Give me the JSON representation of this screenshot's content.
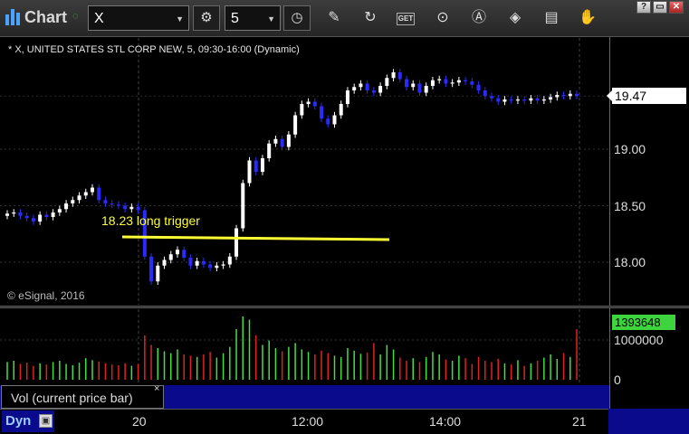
{
  "toolbar": {
    "title": "Chart",
    "symbol": "X",
    "interval": "5",
    "icons": [
      "gear-icon",
      "clock-icon",
      "pencil-icon",
      "refresh-icon",
      "get-icon",
      "play-icon",
      "alert-icon",
      "tag-icon",
      "message-icon",
      "thumb-icon"
    ],
    "get_label": "GET",
    "window_buttons": [
      "?",
      "▭",
      "✕"
    ]
  },
  "chart": {
    "symbol_line": "* X, UNITED STATES STL CORP NEW, 5, 09:30-16:00 (Dynamic)",
    "copyright": "© eSignal, 2016",
    "annotation": "18.23 long trigger",
    "last_price": "19.47",
    "y_ticks": [
      "19.00",
      "18.50",
      "18.00"
    ],
    "vol_last": "1393648",
    "vol_ticks": [
      "1000000",
      "0"
    ],
    "vol_label": "Vol (current price bar)",
    "vol_close": "×",
    "dyn": "Dyn",
    "x_ticks": [
      "20",
      "12:00",
      "14:00",
      "21"
    ],
    "colors": {
      "up": "#ffffff",
      "down": "#2a2aff",
      "vol_up": "#44dd44",
      "vol_down": "#dd2222",
      "trigger": "#ffff33"
    }
  },
  "chart_data": {
    "type": "line",
    "y_range": [
      17.7,
      19.8
    ],
    "trigger_price": 18.23,
    "closes": [
      18.43,
      18.44,
      18.41,
      18.39,
      18.36,
      18.42,
      18.4,
      18.44,
      18.47,
      18.52,
      18.55,
      18.59,
      18.62,
      18.66,
      18.55,
      18.52,
      18.51,
      18.5,
      18.47,
      18.49,
      18.46,
      18.05,
      17.83,
      17.97,
      18.02,
      18.07,
      18.11,
      18.04,
      17.97,
      18.01,
      17.98,
      17.95,
      17.97,
      17.98,
      18.05,
      18.3,
      18.7,
      18.9,
      18.8,
      18.92,
      19.05,
      19.09,
      19.02,
      19.13,
      19.3,
      19.4,
      19.42,
      19.38,
      19.27,
      19.22,
      19.3,
      19.4,
      19.52,
      19.55,
      19.58,
      19.52,
      19.5,
      19.56,
      19.63,
      19.68,
      19.62,
      19.55,
      19.58,
      19.5,
      19.56,
      19.61,
      19.62,
      19.58,
      19.59,
      19.61,
      19.6,
      19.57,
      19.52,
      19.47,
      19.45,
      19.42,
      19.44,
      19.43,
      19.44,
      19.43,
      19.45,
      19.43,
      19.44,
      19.46,
      19.48,
      19.47,
      19.49,
      19.47
    ],
    "volumes_rel": [
      0.28,
      0.3,
      0.25,
      0.27,
      0.22,
      0.26,
      0.24,
      0.28,
      0.3,
      0.25,
      0.23,
      0.27,
      0.34,
      0.31,
      0.29,
      0.26,
      0.24,
      0.23,
      0.26,
      0.22,
      0.25,
      0.7,
      0.55,
      0.5,
      0.45,
      0.42,
      0.48,
      0.4,
      0.38,
      0.36,
      0.4,
      0.44,
      0.35,
      0.42,
      0.52,
      0.8,
      1.0,
      0.95,
      0.7,
      0.55,
      0.62,
      0.5,
      0.45,
      0.52,
      0.58,
      0.48,
      0.44,
      0.4,
      0.46,
      0.42,
      0.38,
      0.36,
      0.5,
      0.46,
      0.41,
      0.43,
      0.58,
      0.4,
      0.55,
      0.48,
      0.35,
      0.3,
      0.34,
      0.28,
      0.36,
      0.44,
      0.4,
      0.32,
      0.3,
      0.38,
      0.34,
      0.25,
      0.36,
      0.3,
      0.28,
      0.33,
      0.26,
      0.24,
      0.31,
      0.22,
      0.26,
      0.3,
      0.35,
      0.4,
      0.33,
      0.42,
      0.36,
      0.8
    ]
  }
}
